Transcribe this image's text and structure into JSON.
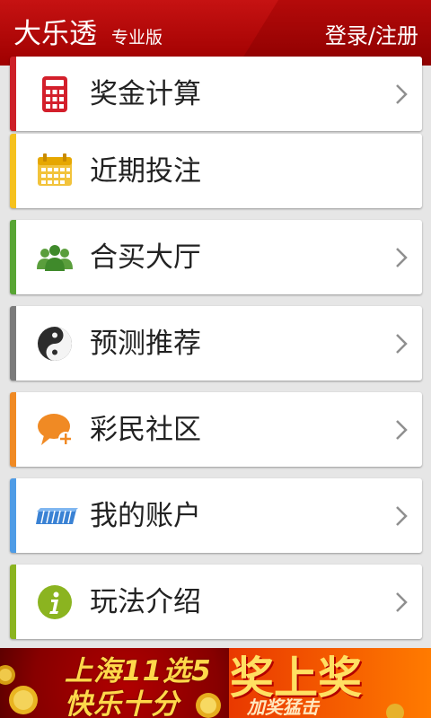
{
  "header": {
    "title": "大乐透",
    "subtitle": "专业版",
    "login_label": "登录/注册"
  },
  "menu": [
    {
      "label": "奖金计算",
      "icon": "calculator-icon",
      "accent": "#cd2028"
    },
    {
      "label": "近期投注",
      "icon": "calendar-icon",
      "accent": "#f5c11e"
    },
    {
      "label": "合买大厅",
      "icon": "group-icon",
      "accent": "#58a534"
    },
    {
      "label": "预测推荐",
      "icon": "yin-yang-icon",
      "accent": "#7b7b7b"
    },
    {
      "label": "彩民社区",
      "icon": "chat-bubble-icon",
      "accent": "#f08a24"
    },
    {
      "label": "我的账户",
      "icon": "wallet-icon",
      "accent": "#4f9ce6"
    },
    {
      "label": "玩法介绍",
      "icon": "info-icon",
      "accent": "#8bb420"
    }
  ],
  "banner": {
    "line1": "上海11选5",
    "line2": "快乐十分",
    "headline": "奖上奖",
    "tagline": "加奖猛击"
  },
  "colors": {
    "header": "#b20000",
    "background": "#e6e6e6",
    "banner_red": "#d80000",
    "banner_orange": "#ff7b00"
  }
}
